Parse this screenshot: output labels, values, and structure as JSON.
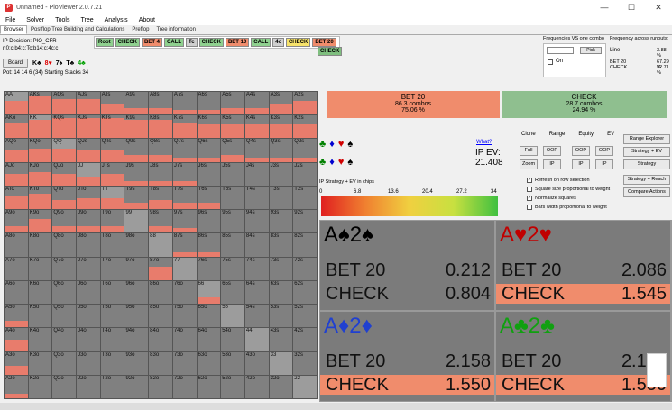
{
  "window": {
    "title": "Unnamed - PioViewer 2.0.7.21",
    "minimize": "—",
    "maximize": "☐",
    "close": "✕"
  },
  "menu": [
    "File",
    "Solver",
    "Tools",
    "Tree",
    "Analysis",
    "About"
  ],
  "tabs": [
    "Browser",
    "Postflop Tree Building and Calculations",
    "Preflop",
    "Tree information"
  ],
  "info": {
    "decision": "IP Decision: PIO_CFR",
    "line": "r:0:c:b4:c:Tc:b14:c:4c:c",
    "pot": "Pot: 14 14 6 (34) Starting Stacks 34"
  },
  "board": {
    "button": "Board",
    "cards": [
      {
        "r": "K",
        "s": "♣",
        "c": "#000"
      },
      {
        "r": "8",
        "s": "♥",
        "c": "#d00"
      },
      {
        "r": "7",
        "s": "♠",
        "c": "#000"
      },
      {
        "r": "T",
        "s": "♣",
        "c": "#000"
      },
      {
        "r": "4",
        "s": "♣",
        "c": "#00a000"
      }
    ]
  },
  "actions": [
    {
      "label": "Root",
      "bg": "#8fd18f"
    },
    {
      "label": "CHECK",
      "bg": "#8fd18f"
    },
    {
      "label": "BET 4",
      "bg": "#f08c6c"
    },
    {
      "label": "CALL",
      "bg": "#8fd18f"
    },
    {
      "label": "Tc",
      "bg": "#cfcfcf"
    },
    {
      "label": "CHECK",
      "bg": "#8fd18f"
    },
    {
      "label": "BET 10",
      "bg": "#f08c6c"
    },
    {
      "label": "CALL",
      "bg": "#8fd18f"
    },
    {
      "label": "4c",
      "bg": "#cfcfcf"
    },
    {
      "label": "CHECK",
      "bg": "#f7e36a"
    },
    {
      "label": "BET 20",
      "bg": "#f08c6c"
    }
  ],
  "action_second_row": "CHECK",
  "freq": {
    "title_a": "Frequencies VS one combo",
    "title_b": "Frequency across runouts:",
    "pick": "Pick",
    "on": "On",
    "line_label": "Line",
    "line_val": "3.88 %",
    "bet_label": "BET 20",
    "bet_val": "67.29 %",
    "check_label": "CHECK",
    "check_val": "32.71 %"
  },
  "summary": {
    "bet": {
      "title": "BET 20",
      "combos": "86.3 combos",
      "pct": "75.06 %"
    },
    "check": {
      "title": "CHECK",
      "combos": "28.7 combos",
      "pct": "24.94 %"
    }
  },
  "suits": [
    [
      {
        "s": "♣",
        "c": "#008000"
      },
      {
        "s": "♦",
        "c": "#0000d0"
      },
      {
        "s": "♥",
        "c": "#d00000"
      },
      {
        "s": "♠",
        "c": "#000"
      }
    ],
    [
      {
        "s": "♣",
        "c": "#008000"
      },
      {
        "s": "♦",
        "c": "#0000d0"
      },
      {
        "s": "♥",
        "c": "#d00000"
      },
      {
        "s": "♠",
        "c": "#000"
      }
    ]
  ],
  "ev": {
    "what": "What?",
    "label": "IP EV:",
    "value": "21.408"
  },
  "ctrl": {
    "labels": [
      "Clone",
      "Range",
      "Equity",
      "EV"
    ],
    "row1": [
      "Full",
      "OOP",
      "OOP",
      "OOP",
      "IP"
    ],
    "row2": [
      "Zoom",
      "IP",
      "IP",
      "IP"
    ],
    "right": [
      "Range Explorer",
      "Strategy + EV",
      "Strategy",
      "Strategy + Reach",
      "Compare Actions"
    ]
  },
  "options": [
    {
      "label": "Refresh on row selection",
      "checked": true
    },
    {
      "label": "Square size proportional to weight",
      "checked": false
    },
    {
      "label": "Normalize squares",
      "checked": true
    },
    {
      "label": "Bars width proportional to weight",
      "checked": false
    }
  ],
  "scale": {
    "title": "IP Strategy + EV in chips",
    "ticks": [
      "0",
      "6.8",
      "13.6",
      "20.4",
      "27.2",
      "34"
    ]
  },
  "combos": [
    {
      "rank": "A",
      "suit1": "♠",
      "rank2": "2",
      "suit2": "♠",
      "color": "#000",
      "bet_label": "BET 20",
      "bet_ev": "0.212",
      "check_label": "CHECK",
      "check_ev": "0.804",
      "bet_freq": 0.0
    },
    {
      "rank": "A",
      "suit1": "♥",
      "rank2": "2",
      "suit2": "♥",
      "color": "#c00000",
      "bet_label": "BET 20",
      "bet_ev": "2.086",
      "check_label": "CHECK",
      "check_ev": "1.545",
      "bet_freq": 1.0
    },
    {
      "rank": "A",
      "suit1": "♦",
      "rank2": "2",
      "suit2": "♦",
      "color": "#2040d0",
      "bet_label": "BET 20",
      "bet_ev": "2.158",
      "check_label": "CHECK",
      "check_ev": "1.550",
      "bet_freq": 1.0
    },
    {
      "rank": "A",
      "suit1": "♣",
      "rank2": "2",
      "suit2": "♣",
      "color": "#10a010",
      "bet_label": "BET 20",
      "bet_ev": "2.158",
      "check_label": "CHECK",
      "check_ev": "1.550",
      "bet_freq": 1.0
    }
  ],
  "grid_hands": [
    [
      "AA",
      "AKs",
      "AQs",
      "AJs",
      "ATs",
      "A9s",
      "A8s",
      "A7s",
      "A6s",
      "A5s",
      "A4s",
      "A3s",
      "A2s"
    ],
    [
      "AKo",
      "KK",
      "KQs",
      "KJs",
      "KTs",
      "K9s",
      "K8s",
      "K7s",
      "K6s",
      "K5s",
      "K4s",
      "K3s",
      "K2s"
    ],
    [
      "AQo",
      "KQo",
      "QQ",
      "QJs",
      "QTs",
      "Q9s",
      "Q8s",
      "Q7s",
      "Q6s",
      "Q5s",
      "Q4s",
      "Q3s",
      "Q2s"
    ],
    [
      "AJo",
      "KJo",
      "QJo",
      "JJ",
      "JTs",
      "J9s",
      "J8s",
      "J7s",
      "J6s",
      "J5s",
      "J4s",
      "J3s",
      "J2s"
    ],
    [
      "ATo",
      "KTo",
      "QTo",
      "JTo",
      "TT",
      "T9s",
      "T8s",
      "T7s",
      "T6s",
      "T5s",
      "T4s",
      "T3s",
      "T2s"
    ],
    [
      "A9o",
      "K9o",
      "Q9o",
      "J9o",
      "T9o",
      "99",
      "98s",
      "97s",
      "96s",
      "95s",
      "94s",
      "93s",
      "92s"
    ],
    [
      "A8o",
      "K8o",
      "Q8o",
      "J8o",
      "T8o",
      "98o",
      "88",
      "87s",
      "86s",
      "85s",
      "84s",
      "83s",
      "82s"
    ],
    [
      "A7o",
      "K7o",
      "Q7o",
      "J7o",
      "T7o",
      "97o",
      "87o",
      "77",
      "76s",
      "75s",
      "74s",
      "73s",
      "72s"
    ],
    [
      "A6o",
      "K6o",
      "Q6o",
      "J6o",
      "T6o",
      "96o",
      "86o",
      "76o",
      "66",
      "65s",
      "64s",
      "63s",
      "62s"
    ],
    [
      "A5o",
      "K5o",
      "Q5o",
      "J5o",
      "T5o",
      "95o",
      "85o",
      "75o",
      "65o",
      "55",
      "54s",
      "53s",
      "52s"
    ],
    [
      "A4o",
      "K4o",
      "Q4o",
      "J4o",
      "T4o",
      "94o",
      "84o",
      "74o",
      "64o",
      "54o",
      "44",
      "43s",
      "42s"
    ],
    [
      "A3o",
      "K3o",
      "Q3o",
      "J3o",
      "T3o",
      "93o",
      "83o",
      "73o",
      "63o",
      "53o",
      "43o",
      "33",
      "32s"
    ],
    [
      "A2o",
      "K2o",
      "Q2o",
      "J2o",
      "T2o",
      "92o",
      "82o",
      "72o",
      "62o",
      "52o",
      "42o",
      "32o",
      "22"
    ]
  ],
  "grid_bet_freq": [
    [
      0.6,
      0.8,
      0.7,
      0.7,
      0.5,
      0.3,
      0.3,
      0.2,
      0.2,
      0.3,
      0.3,
      0.5,
      0.6
    ],
    [
      0.7,
      0.8,
      0.9,
      0.9,
      0.9,
      0.8,
      0.8,
      0.7,
      0.6,
      0.6,
      0.6,
      0.6,
      0.6
    ],
    [
      0.5,
      0.6,
      0.6,
      0.5,
      0.5,
      0.3,
      0.3,
      0.2,
      0.2,
      0.3,
      0.2,
      0.2,
      0.2
    ],
    [
      0.5,
      0.6,
      0.5,
      0.4,
      0.5,
      0.2,
      0.2,
      0.2,
      0.0,
      0.0,
      0.0,
      0.0,
      0.0
    ],
    [
      0.6,
      0.7,
      0.4,
      0.5,
      0.5,
      0.3,
      0.4,
      0.3,
      0.3,
      0.0,
      0.0,
      0.0,
      0.0
    ],
    [
      0.3,
      0.6,
      0.3,
      0.3,
      0.3,
      0.0,
      0.3,
      0.2,
      0.0,
      0.0,
      0.0,
      0.0,
      0.0
    ],
    [
      0.0,
      0.0,
      0.0,
      0.0,
      0.0,
      0.0,
      0.0,
      0.2,
      0.2,
      0.0,
      0.0,
      0.0,
      0.0
    ],
    [
      0.0,
      0.0,
      0.0,
      0.0,
      0.0,
      0.0,
      0.6,
      0.0,
      0.0,
      0.0,
      0.0,
      0.0,
      0.0
    ],
    [
      0.0,
      0.0,
      0.0,
      0.0,
      0.0,
      0.0,
      0.0,
      0.0,
      0.3,
      0.0,
      0.0,
      0.0,
      0.0
    ],
    [
      0.3,
      0.0,
      0.0,
      0.0,
      0.0,
      0.0,
      0.0,
      0.0,
      0.0,
      0.0,
      0.0,
      0.0,
      0.0
    ],
    [
      0.5,
      0.0,
      0.0,
      0.0,
      0.0,
      0.0,
      0.0,
      0.0,
      0.0,
      0.0,
      0.0,
      0.0,
      0.0
    ],
    [
      0.4,
      0.0,
      0.0,
      0.0,
      0.0,
      0.0,
      0.0,
      0.0,
      0.0,
      0.0,
      0.0,
      0.0,
      0.0
    ],
    [
      0.2,
      0.0,
      0.0,
      0.0,
      0.0,
      0.0,
      0.0,
      0.0,
      0.0,
      0.0,
      0.0,
      0.0,
      0.0
    ]
  ]
}
